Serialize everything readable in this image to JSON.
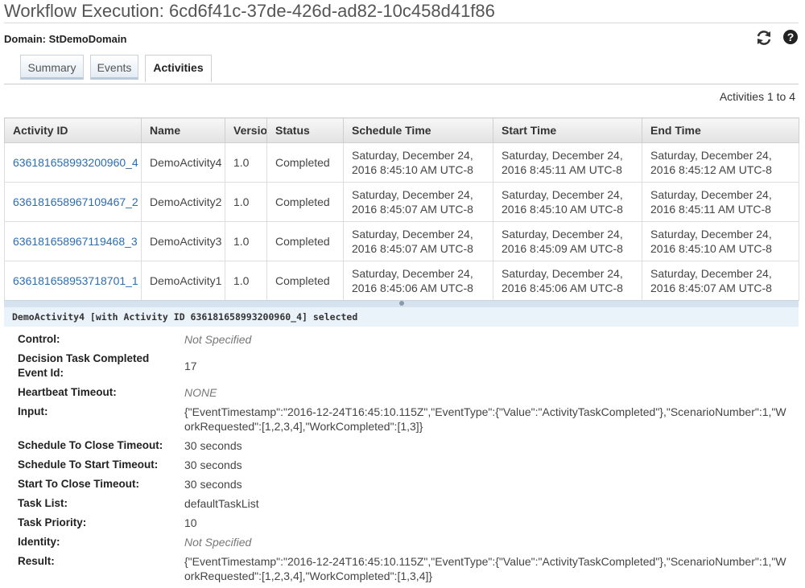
{
  "header": {
    "title": "Workflow Execution: 6cd6f41c-37de-426d-ad82-10c458d41f86",
    "domain": "Domain: StDemoDomain",
    "refresh_icon": "refresh-icon",
    "help_icon": "help-icon"
  },
  "tabs": [
    {
      "label": "Summary",
      "active": false
    },
    {
      "label": "Events",
      "active": false
    },
    {
      "label": "Activities",
      "active": true
    }
  ],
  "activities": {
    "count_text": "Activities 1 to 4",
    "columns": [
      "Activity ID",
      "Name",
      "Versio",
      "Status",
      "Schedule Time",
      "Start Time",
      "End Time"
    ],
    "rows": [
      {
        "id": "636181658993200960_4",
        "name": "DemoActivity4",
        "version": "1.0",
        "status": "Completed",
        "schedule": [
          "Saturday, December 24,",
          "2016 8:45:10 AM UTC-8"
        ],
        "start": [
          "Saturday, December 24,",
          "2016 8:45:11 AM UTC-8"
        ],
        "end": [
          "Saturday, December 24,",
          "2016 8:45:12 AM UTC-8"
        ]
      },
      {
        "id": "636181658967109467_2",
        "name": "DemoActivity2",
        "version": "1.0",
        "status": "Completed",
        "schedule": [
          "Saturday, December 24,",
          "2016 8:45:07 AM UTC-8"
        ],
        "start": [
          "Saturday, December 24,",
          "2016 8:45:10 AM UTC-8"
        ],
        "end": [
          "Saturday, December 24,",
          "2016 8:45:11 AM UTC-8"
        ]
      },
      {
        "id": "636181658967119468_3",
        "name": "DemoActivity3",
        "version": "1.0",
        "status": "Completed",
        "schedule": [
          "Saturday, December 24,",
          "2016 8:45:07 AM UTC-8"
        ],
        "start": [
          "Saturday, December 24,",
          "2016 8:45:09 AM UTC-8"
        ],
        "end": [
          "Saturday, December 24,",
          "2016 8:45:10 AM UTC-8"
        ]
      },
      {
        "id": "636181658953718701_1",
        "name": "DemoActivity1",
        "version": "1.0",
        "status": "Completed",
        "schedule": [
          "Saturday, December 24,",
          "2016 8:45:06 AM UTC-8"
        ],
        "start": [
          "Saturday, December 24,",
          "2016 8:45:06 AM UTC-8"
        ],
        "end": [
          "Saturday, December 24,",
          "2016 8:45:07 AM UTC-8"
        ]
      }
    ]
  },
  "selection": {
    "text": "DemoActivity4 [with Activity ID 636181658993200960_4] selected"
  },
  "details": [
    {
      "label": "Control:",
      "value": "Not Specified",
      "muted": true
    },
    {
      "label": "Decision Task Completed Event Id:",
      "value": "17",
      "muted": false
    },
    {
      "label": "Heartbeat Timeout:",
      "value": "NONE",
      "muted": true
    },
    {
      "label": "Input:",
      "value": "{\"EventTimestamp\":\"2016-12-24T16:45:10.115Z\",\"EventType\":{\"Value\":\"ActivityTaskCompleted\"},\"ScenarioNumber\":1,\"WorkRequested\":[1,2,3,4],\"WorkCompleted\":[1,3]}",
      "muted": false
    },
    {
      "label": "Schedule To Close Timeout:",
      "value": "30 seconds",
      "muted": false
    },
    {
      "label": "Schedule To Start Timeout:",
      "value": "30 seconds",
      "muted": false
    },
    {
      "label": "Start To Close Timeout:",
      "value": "30 seconds",
      "muted": false
    },
    {
      "label": "Task List:",
      "value": "defaultTaskList",
      "muted": false
    },
    {
      "label": "Task Priority:",
      "value": "10",
      "muted": false
    },
    {
      "label": "Identity:",
      "value": "Not Specified",
      "muted": true
    },
    {
      "label": "Result:",
      "value": "{\"EventTimestamp\":\"2016-12-24T16:45:10.115Z\",\"EventType\":{\"Value\":\"ActivityTaskCompleted\"},\"ScenarioNumber\":1,\"WorkRequested\":[1,2,3,4],\"WorkCompleted\":[1,3,4]}",
      "muted": false
    }
  ]
}
